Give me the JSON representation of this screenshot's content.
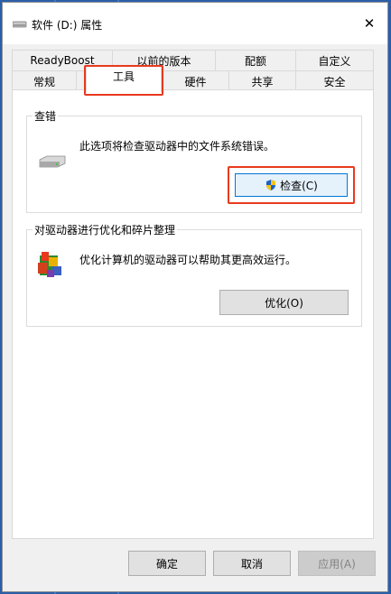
{
  "window": {
    "title": "软件 (D:) 属性",
    "close_glyph": "✕",
    "title_icon": "drive-icon"
  },
  "tabs": {
    "row1": [
      "ReadyBoost",
      "以前的版本",
      "配额",
      "自定义"
    ],
    "row2": [
      "常规",
      "工具",
      "硬件",
      "共享",
      "安全"
    ],
    "selected": "工具"
  },
  "error_check": {
    "title": "查错",
    "description": "此选项将检查驱动器中的文件系统错误。",
    "button": "检查(C)",
    "icon": "drive-icon",
    "button_icon": "uac-shield-icon"
  },
  "optimize": {
    "title": "对驱动器进行优化和碎片整理",
    "description": "优化计算机的驱动器可以帮助其更高效运行。",
    "button": "优化(O)",
    "icon": "defrag-icon"
  },
  "footer": {
    "ok": "确定",
    "cancel": "取消",
    "apply": "应用(A)"
  },
  "colors": {
    "highlight": "#e8391e",
    "button_focus": "#0078d7"
  }
}
